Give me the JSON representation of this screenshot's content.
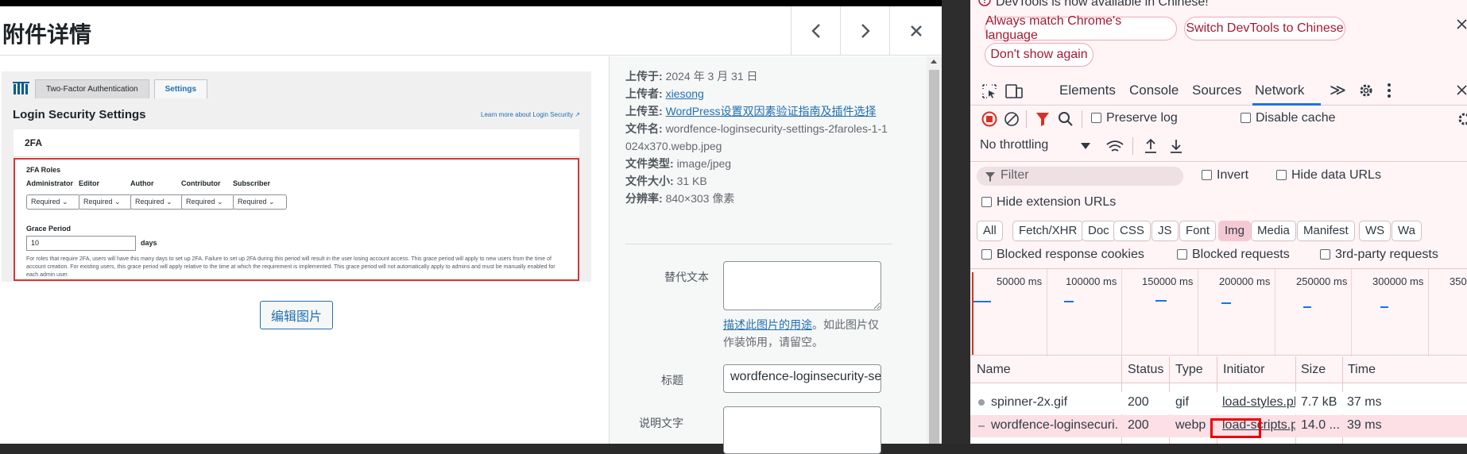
{
  "modal": {
    "title": "附件详情",
    "prev_label": "<",
    "next_label": ">",
    "close_label": "×"
  },
  "preview": {
    "tabs": [
      "Two-Factor Authentication",
      "Settings"
    ],
    "heading": "Login Security Settings",
    "learn_more": "Learn more about Login Security ↗",
    "card_title": "2FA",
    "roles_label": "2FA Roles",
    "roles": [
      "Administrator",
      "Editor",
      "Author",
      "Contributor",
      "Subscriber"
    ],
    "role_value": "Required ⌄",
    "grace_label": "Grace Period",
    "grace_value": "10",
    "grace_unit": "days",
    "note": "For roles that require 2FA, users will have this many days to set up 2FA. Failure to set up 2FA during this period will result in the user losing account access. This grace period will apply to new users from the time of account creation. For existing users, this grace period will apply relative to the time at which the requirement is implemented. This grace period will not automatically apply to admins and must be manually enabled for each admin user."
  },
  "edit_image_label": "编辑图片",
  "details": {
    "uploaded_on_label": "上传于:",
    "uploaded_on": "2024 年 3 月 31 日",
    "uploaded_by_label": "上传者:",
    "uploaded_by": "xiesong",
    "uploaded_to_label": "上传至:",
    "uploaded_to": "WordPress设置双因素验证指南及插件选择",
    "file_name_label": "文件名:",
    "file_name": "wordfence-loginsecurity-settings-2faroles-1-1024x370.webp.jpeg",
    "file_type_label": "文件类型:",
    "file_type": "image/jpeg",
    "file_size_label": "文件大小:",
    "file_size": "31 KB",
    "dimensions_label": "分辨率:",
    "dimensions": "840×303 像素"
  },
  "fields": {
    "alt_label": "替代文本",
    "alt_help_link": "描述此图片的用途",
    "alt_help_rest": "。如此图片仅作装饰用，请留空。",
    "title_label": "标题",
    "title_value": "wordfence-loginsecurity-se",
    "caption_label": "说明文字"
  },
  "devtools": {
    "infobar_text": "DevTools is now available in Chinese!",
    "btn_match": "Always match Chrome's language",
    "btn_switch": "Switch DevTools to Chinese",
    "btn_dont": "Don't show again",
    "tabs": [
      "Elements",
      "Console",
      "Sources",
      "Network"
    ],
    "more_tabs": "≫",
    "preserve_log": "Preserve log",
    "disable_cache": "Disable cache",
    "throttling": "No throttling",
    "filter_placeholder": "Filter",
    "invert": "Invert",
    "hide_data_urls": "Hide data URLs",
    "hide_extension_urls": "Hide extension URLs",
    "type_filters": [
      "All",
      "Fetch/XHR",
      "Doc",
      "CSS",
      "JS",
      "Font",
      "Img",
      "Media",
      "Manifest",
      "WS",
      "Wa"
    ],
    "active_filter": "Img",
    "blocked_cookies": "Blocked response cookies",
    "blocked_requests": "Blocked requests",
    "third_party": "3rd-party requests",
    "timeline_ticks": [
      "50000 ms",
      "100000 ms",
      "150000 ms",
      "200000 ms",
      "250000 ms",
      "300000 ms",
      "350"
    ],
    "columns": [
      "Name",
      "Status",
      "Type",
      "Initiator",
      "Size",
      "Time"
    ],
    "rows": [
      {
        "name": "spinner-2x.gif",
        "status": "200",
        "type": "gif",
        "initiator": "load-styles.ph",
        "size": "7.7 kB",
        "time": "37 ms"
      },
      {
        "name": "wordfence-loginsecuri...",
        "status": "200",
        "type": "webp",
        "initiator": "load-scripts.p",
        "size": "14.0 ...",
        "time": "39 ms"
      }
    ]
  },
  "colors": {
    "accent": "#2271b1",
    "devtools_tint": "#fff4f6",
    "highlight": "#e00000"
  }
}
